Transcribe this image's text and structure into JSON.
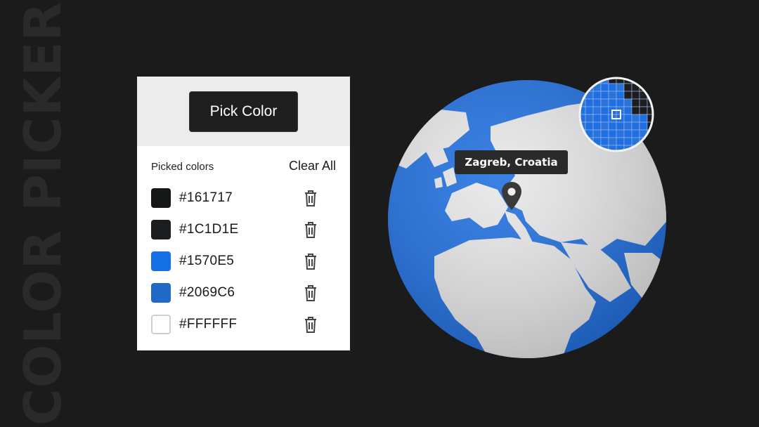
{
  "side_title": "COLOR PICKER",
  "panel": {
    "pick_button_label": "Pick Color",
    "picked_label": "Picked colors",
    "clear_all_label": "Clear All",
    "colors": [
      {
        "hex_label": "#161717",
        "swatch": "#161717"
      },
      {
        "hex_label": "#1C1D1E",
        "swatch": "#1c1d1e"
      },
      {
        "hex_label": "#1570E5",
        "swatch": "#1570e5"
      },
      {
        "hex_label": "#2069C6",
        "swatch": "#2069c6"
      },
      {
        "hex_label": "#FFFFFF",
        "swatch": "#ffffff"
      }
    ]
  },
  "map": {
    "location_label": "Zagreb, Croatia",
    "ocean_color": "#1f6fe0",
    "land_color": "#e8e8ea",
    "icons": [
      "trash-icon",
      "map-pin-icon",
      "magnifier-grid"
    ]
  }
}
